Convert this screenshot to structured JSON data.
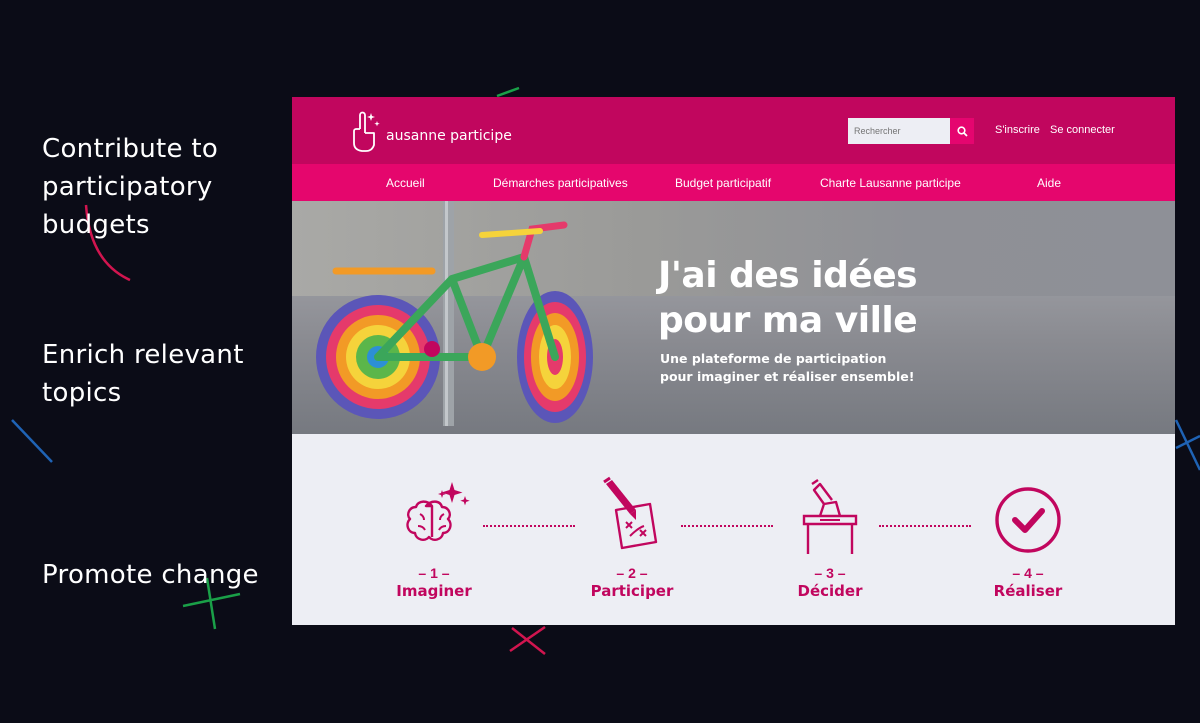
{
  "left_panel": {
    "line1": "Contribute to",
    "line2": "participatory",
    "line3": "budgets",
    "line4": "Enrich relevant",
    "line5": "topics",
    "line6": "Promote change"
  },
  "site": {
    "logo_text": "ausanne participe",
    "search": {
      "placeholder": "Rechercher"
    },
    "auth": {
      "signup": "S'inscrire",
      "login": "Se connecter"
    },
    "nav": [
      "Accueil",
      "Démarches participatives",
      "Budget participatif",
      "Charte Lausanne participe",
      "Aide"
    ],
    "hero": {
      "title_line1": "J'ai des idées",
      "title_line2": "pour ma ville",
      "subtitle_line1": "Une plateforme de participation",
      "subtitle_line2": "pour imaginer et réaliser ensemble!"
    },
    "steps": [
      {
        "number": "– 1 –",
        "label": "Imaginer",
        "icon": "brain-icon"
      },
      {
        "number": "– 2 –",
        "label": "Participer",
        "icon": "pencil-paper-icon"
      },
      {
        "number": "– 3 –",
        "label": "Décider",
        "icon": "ballot-box-icon"
      },
      {
        "number": "– 4 –",
        "label": "Réaliser",
        "icon": "check-circle-icon"
      }
    ]
  },
  "colors": {
    "background": "#0b0c17",
    "brand_dark": "#c1065e",
    "brand": "#e5066d",
    "steps_bg": "#edeef4"
  }
}
